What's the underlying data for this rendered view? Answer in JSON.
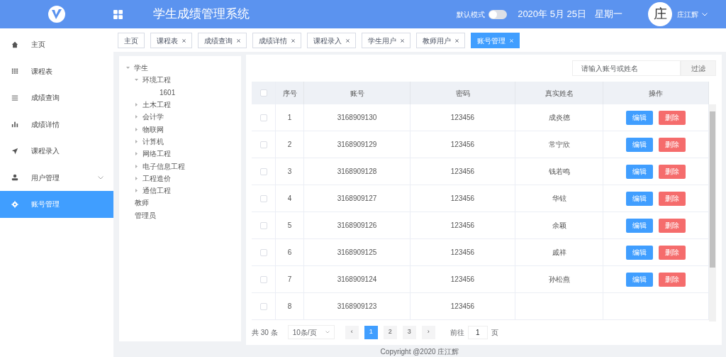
{
  "header": {
    "title": "学生成绩管理系统",
    "mode_label": "默认模式",
    "mode_switch": {
      "on": false
    },
    "date": "2020年 5月 25日",
    "weekday": "星期一",
    "avatar": "庄",
    "user": "庄江辉"
  },
  "sidebar": {
    "items": [
      {
        "label": "主页",
        "selected": false
      },
      {
        "label": "课程表",
        "selected": false
      },
      {
        "label": "成绩查询",
        "selected": false
      },
      {
        "label": "成绩详情",
        "selected": false
      },
      {
        "label": "课程录入",
        "selected": false
      },
      {
        "label": "用户管理",
        "selected": false,
        "expandable": true
      },
      {
        "label": "账号管理",
        "selected": true
      }
    ]
  },
  "tabs": [
    {
      "label": "主页",
      "closable": false,
      "selected": false
    },
    {
      "label": "课程表",
      "closable": true,
      "selected": false
    },
    {
      "label": "成绩查询",
      "closable": true,
      "selected": false
    },
    {
      "label": "成绩详情",
      "closable": true,
      "selected": false
    },
    {
      "label": "课程录入",
      "closable": true,
      "selected": false
    },
    {
      "label": "学生用户",
      "closable": true,
      "selected": false
    },
    {
      "label": "教师用户",
      "closable": true,
      "selected": false
    },
    {
      "label": "账号管理",
      "closable": true,
      "selected": true
    }
  ],
  "tree": [
    {
      "label": "学生",
      "expanded": true,
      "children": [
        {
          "label": "环境工程",
          "expanded": true,
          "children": [
            {
              "label": "1601"
            }
          ]
        },
        {
          "label": "土木工程",
          "expanded": false
        },
        {
          "label": "会计学",
          "expanded": false
        },
        {
          "label": "物联网",
          "expanded": false
        },
        {
          "label": "计算机",
          "expanded": false
        },
        {
          "label": "网络工程",
          "expanded": false
        },
        {
          "label": "电子信息工程",
          "expanded": false
        },
        {
          "label": "工程造价",
          "expanded": false
        },
        {
          "label": "通信工程",
          "expanded": false
        }
      ]
    },
    {
      "label": "教师"
    },
    {
      "label": "管理员"
    }
  ],
  "search": {
    "placeholder": "请输入账号或姓名",
    "button": "过滤"
  },
  "table": {
    "select_all_checked": false,
    "columns": [
      "序号",
      "账号",
      "密码",
      "真实姓名",
      "操作"
    ],
    "rows": [
      {
        "index": "1",
        "account": "3168909130",
        "password": "123456",
        "name": "成炎德",
        "checked": false,
        "edit": "编辑",
        "delete": "删除"
      },
      {
        "index": "2",
        "account": "3168909129",
        "password": "123456",
        "name": "常宁欣",
        "checked": false,
        "edit": "编辑",
        "delete": "删除"
      },
      {
        "index": "3",
        "account": "3168909128",
        "password": "123456",
        "name": "钱若鸣",
        "checked": false,
        "edit": "编辑",
        "delete": "删除"
      },
      {
        "index": "4",
        "account": "3168909127",
        "password": "123456",
        "name": "华铉",
        "checked": false,
        "edit": "编辑",
        "delete": "删除"
      },
      {
        "index": "5",
        "account": "3168909126",
        "password": "123456",
        "name": "余颖",
        "checked": false,
        "edit": "编辑",
        "delete": "删除"
      },
      {
        "index": "6",
        "account": "3168909125",
        "password": "123456",
        "name": "戚祥",
        "checked": false,
        "edit": "编辑",
        "delete": "删除"
      },
      {
        "index": "7",
        "account": "3168909124",
        "password": "123456",
        "name": "孙松燕",
        "checked": false,
        "edit": "编辑",
        "delete": "删除"
      },
      {
        "index": "8",
        "account": "3168909123",
        "password": "123456",
        "checked": false
      }
    ]
  },
  "pagination": {
    "total": "共 30 条",
    "page_size": "10条/页",
    "prev": "‹",
    "next": "›",
    "pages": [
      {
        "label": "1",
        "selected": true
      },
      {
        "label": "2",
        "selected": false
      },
      {
        "label": "3",
        "selected": false
      }
    ],
    "goto_label": "前往",
    "goto_value": "1",
    "page_unit": "页"
  },
  "footer": "Copyright @2020 庄江辉"
}
